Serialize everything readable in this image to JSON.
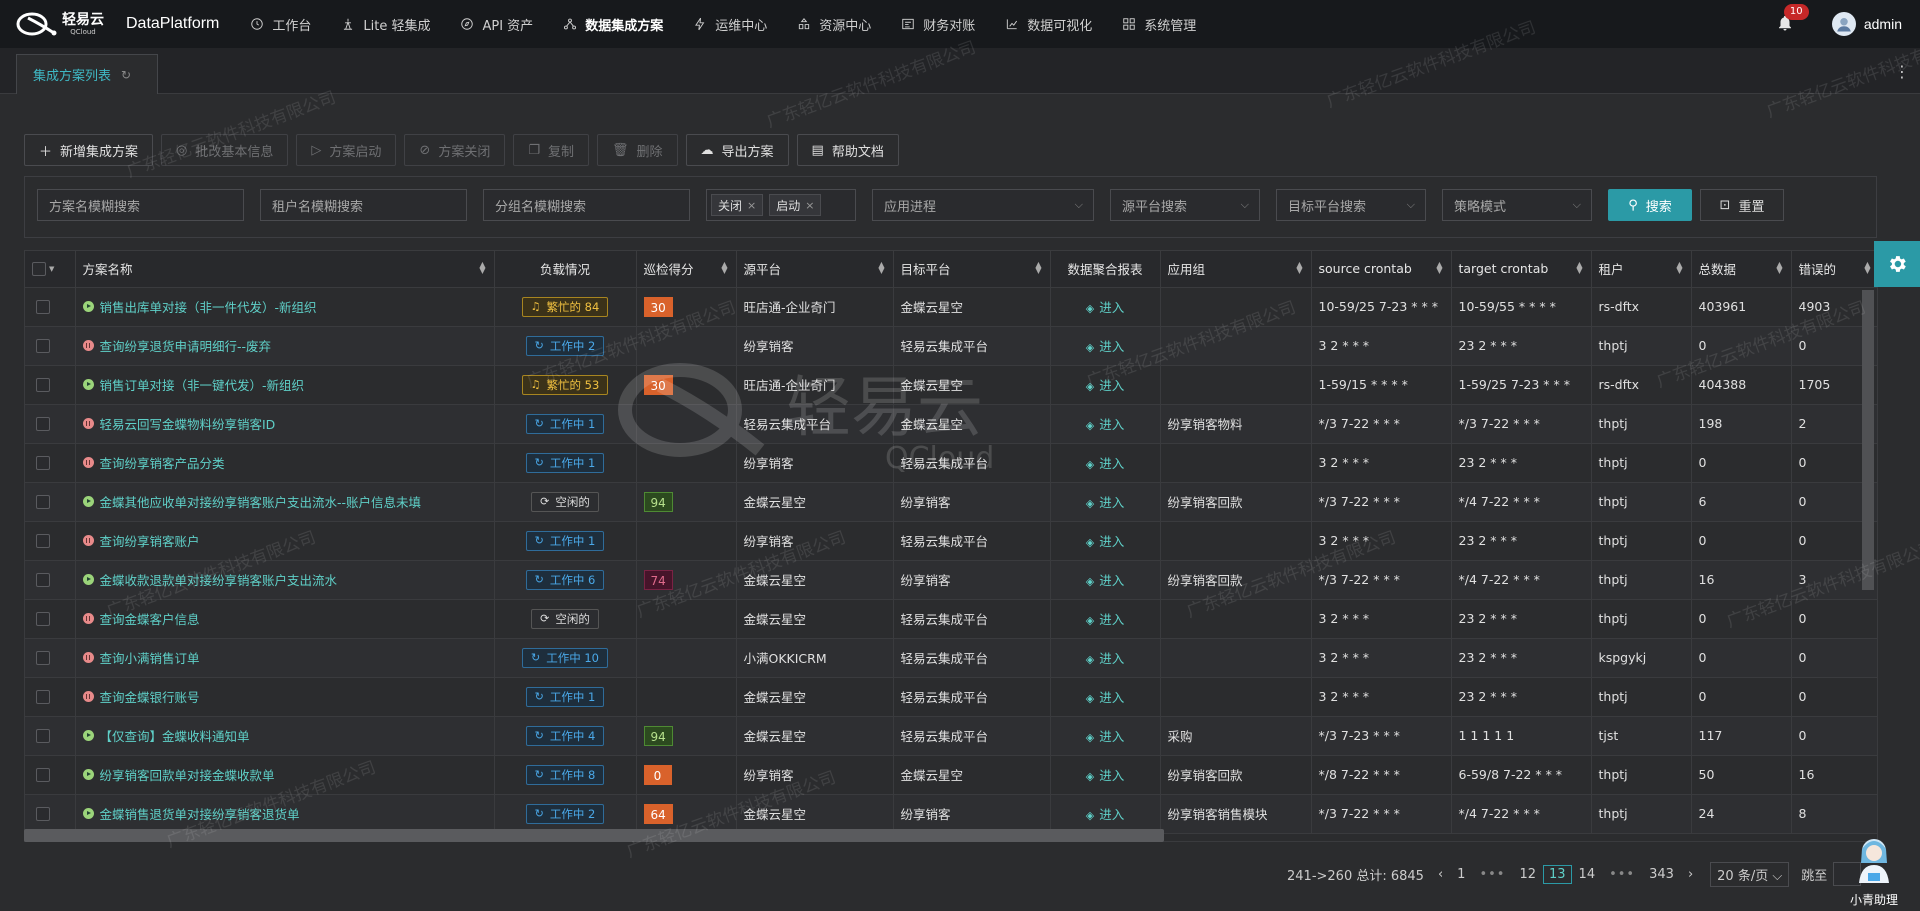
{
  "brand": {
    "logo_cn": "轻易云",
    "logo_en": "QCloud",
    "app_name": "DataPlatform"
  },
  "nav": [
    {
      "label": "工作台",
      "icon": "clock-icon"
    },
    {
      "label": "Lite 轻集成",
      "icon": "lite-icon"
    },
    {
      "label": "API 资产",
      "icon": "compass-icon"
    },
    {
      "label": "数据集成方案",
      "icon": "integration-icon",
      "active": true
    },
    {
      "label": "运维中心",
      "icon": "bolt-icon"
    },
    {
      "label": "资源中心",
      "icon": "resource-icon"
    },
    {
      "label": "财务对账",
      "icon": "finance-icon"
    },
    {
      "label": "数据可视化",
      "icon": "chart-icon"
    },
    {
      "label": "系统管理",
      "icon": "system-icon"
    }
  ],
  "header": {
    "notif_count": "10",
    "username": "admin"
  },
  "tab": {
    "label": "集成方案列表"
  },
  "toolbar": {
    "add": "新增集成方案",
    "batch_edit": "批改基本信息",
    "start": "方案启动",
    "close": "方案关闭",
    "copy": "复制",
    "delete": "删除",
    "export": "导出方案",
    "help": "帮助文档"
  },
  "filters": {
    "name_placeholder": "方案名模糊搜索",
    "tenant_placeholder": "租户名模糊搜索",
    "group_placeholder": "分组名模糊搜索",
    "status_chips": [
      "关闭",
      "启动"
    ],
    "process_placeholder": "应用进程",
    "source_placeholder": "源平台搜索",
    "target_placeholder": "目标平台搜索",
    "strategy_placeholder": "策略模式",
    "search_label": "搜索",
    "reset_label": "重置"
  },
  "table": {
    "columns": {
      "name": "方案名称",
      "load": "负载情况",
      "score": "巡检得分",
      "source": "源平台",
      "target": "目标平台",
      "report": "数据聚合报表",
      "group": "应用组",
      "source_cron": "source crontab",
      "target_cron": "target crontab",
      "tenant": "租户",
      "total": "总数据",
      "errors": "错误的"
    },
    "enter_label": "进入",
    "rows": [
      {
        "status": "run",
        "name": "销售出库单对接（非一件代发）-新组织",
        "load_type": "busy",
        "load": "繁忙的 84",
        "score": "30",
        "score_type": "orange",
        "source": "旺店通-企业奇门",
        "target": "金蝶云星空",
        "group": "",
        "scron": "10-59/25 7-23 * * *",
        "tcron": "10-59/55 * * * *",
        "tenant": "rs-dftx",
        "total": "403961",
        "errors": "4903"
      },
      {
        "status": "stop",
        "name": "查询纷享退货申请明细行--废弃",
        "load_type": "work",
        "load": "工作中 2",
        "score": "",
        "score_type": "",
        "source": "纷享销客",
        "target": "轻易云集成平台",
        "group": "",
        "scron": "3 2 * * *",
        "tcron": "23 2 * * *",
        "tenant": "thptj",
        "total": "0",
        "errors": "0"
      },
      {
        "status": "run",
        "name": "销售订单对接（非一键代发）-新组织",
        "load_type": "busy",
        "load": "繁忙的 53",
        "score": "30",
        "score_type": "orange",
        "source": "旺店通-企业奇门",
        "target": "金蝶云星空",
        "group": "",
        "scron": "1-59/15 * * * *",
        "tcron": "1-59/25 7-23 * * *",
        "tenant": "rs-dftx",
        "total": "404388",
        "errors": "1705"
      },
      {
        "status": "stop",
        "name": "轻易云回写金蝶物料纷享销客ID",
        "load_type": "work",
        "load": "工作中 1",
        "score": "",
        "score_type": "",
        "source": "轻易云集成平台",
        "target": "金蝶云星空",
        "group": "纷享销客物料",
        "scron": "*/3 7-22 * * *",
        "tcron": "*/3 7-22 * * *",
        "tenant": "thptj",
        "total": "198",
        "errors": "2"
      },
      {
        "status": "stop",
        "name": "查询纷享销客产品分类",
        "load_type": "work",
        "load": "工作中 1",
        "score": "",
        "score_type": "",
        "source": "纷享销客",
        "target": "轻易云集成平台",
        "group": "",
        "scron": "3 2 * * *",
        "tcron": "23 2 * * *",
        "tenant": "thptj",
        "total": "0",
        "errors": "0"
      },
      {
        "status": "run",
        "name": "金蝶其他应收单对接纷享销客账户支出流水--账户信息未填",
        "load_type": "idle",
        "load": "空闲的",
        "score": "94",
        "score_type": "green",
        "source": "金蝶云星空",
        "target": "纷享销客",
        "group": "纷享销客回款",
        "scron": "*/3 7-22 * * *",
        "tcron": "*/4 7-22 * * *",
        "tenant": "thptj",
        "total": "6",
        "errors": "0"
      },
      {
        "status": "stop",
        "name": "查询纷享销客账户",
        "load_type": "work",
        "load": "工作中 1",
        "score": "",
        "score_type": "",
        "source": "纷享销客",
        "target": "轻易云集成平台",
        "group": "",
        "scron": "3 2 * * *",
        "tcron": "23 2 * * *",
        "tenant": "thptj",
        "total": "0",
        "errors": "0"
      },
      {
        "status": "run",
        "name": "金蝶收款退款单对接纷享销客账户支出流水",
        "load_type": "work",
        "load": "工作中 6",
        "score": "74",
        "score_type": "red",
        "source": "金蝶云星空",
        "target": "纷享销客",
        "group": "纷享销客回款",
        "scron": "*/3 7-22 * * *",
        "tcron": "*/4 7-22 * * *",
        "tenant": "thptj",
        "total": "16",
        "errors": "3"
      },
      {
        "status": "stop",
        "name": "查询金蝶客户信息",
        "load_type": "idle",
        "load": "空闲的",
        "score": "",
        "score_type": "",
        "source": "金蝶云星空",
        "target": "轻易云集成平台",
        "group": "",
        "scron": "3 2 * * *",
        "tcron": "23 2 * * *",
        "tenant": "thptj",
        "total": "0",
        "errors": "0"
      },
      {
        "status": "stop",
        "name": "查询小满销售订单",
        "load_type": "work",
        "load": "工作中 10",
        "score": "",
        "score_type": "",
        "source": "小满OKKICRM",
        "target": "轻易云集成平台",
        "group": "",
        "scron": "3 2 * * *",
        "tcron": "23 2 * * *",
        "tenant": "kspgykj",
        "total": "0",
        "errors": "0"
      },
      {
        "status": "stop",
        "name": "查询金蝶银行账号",
        "load_type": "work",
        "load": "工作中 1",
        "score": "",
        "score_type": "",
        "source": "金蝶云星空",
        "target": "轻易云集成平台",
        "group": "",
        "scron": "3 2 * * *",
        "tcron": "23 2 * * *",
        "tenant": "thptj",
        "total": "0",
        "errors": "0"
      },
      {
        "status": "run",
        "name": "【仅查询】金蝶收料通知单",
        "load_type": "work",
        "load": "工作中 4",
        "score": "94",
        "score_type": "green",
        "source": "金蝶云星空",
        "target": "轻易云集成平台",
        "group": "采购",
        "scron": "*/3 7-23 * * *",
        "tcron": "1 1 1 1 1",
        "tenant": "tjst",
        "total": "117",
        "errors": "0"
      },
      {
        "status": "run",
        "name": "纷享销客回款单对接金蝶收款单",
        "load_type": "work",
        "load": "工作中 8",
        "score": "0",
        "score_type": "orange",
        "source": "纷享销客",
        "target": "金蝶云星空",
        "group": "纷享销客回款",
        "scron": "*/8 7-22 * * *",
        "tcron": "6-59/8 7-22 * * *",
        "tenant": "thptj",
        "total": "50",
        "errors": "16"
      },
      {
        "status": "run",
        "name": "金蝶销售退货单对接纷享销客退货单",
        "load_type": "work",
        "load": "工作中 2",
        "score": "64",
        "score_type": "orange",
        "source": "金蝶云星空",
        "target": "纷享销客",
        "group": "纷享销客销售模块",
        "scron": "*/3 7-22 * * *",
        "tcron": "*/4 7-22 * * *",
        "tenant": "thptj",
        "total": "24",
        "errors": "8"
      }
    ]
  },
  "pagination": {
    "summary": "241->260 总计: 6845",
    "pages": [
      "1",
      "12",
      "13",
      "14",
      "343"
    ],
    "current": "13",
    "page_size": "20 条/页",
    "jump_label": "跳至"
  },
  "assistant": {
    "label": "小青助理"
  },
  "watermark": {
    "text": "广东轻亿云软件科技有限公司",
    "big_cn": "轻易云",
    "big_en": "QCloud"
  }
}
